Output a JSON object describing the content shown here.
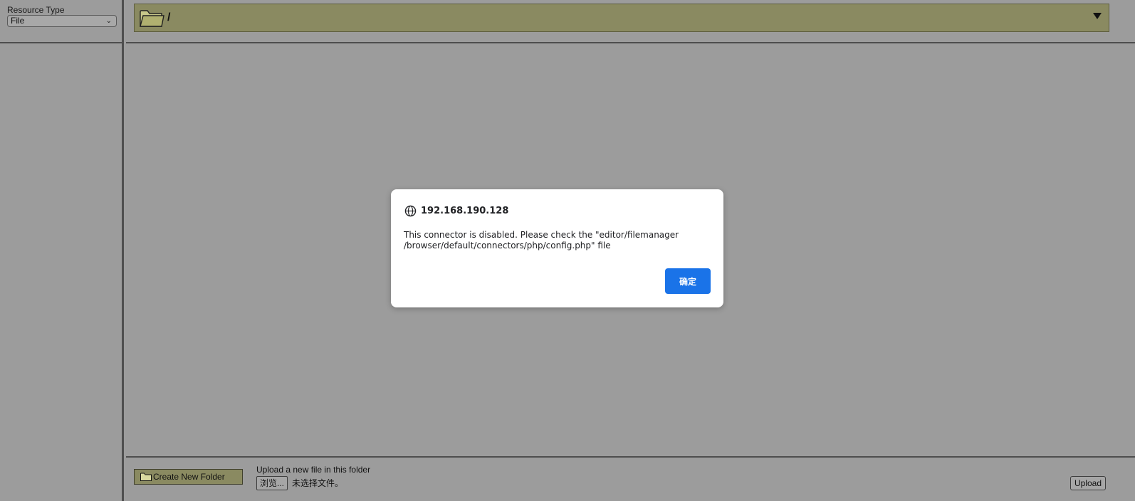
{
  "sidebar": {
    "resource_type_label": "Resource Type",
    "resource_type_value": "File"
  },
  "path_bar": {
    "current_path": "/"
  },
  "dialog": {
    "host": "192.168.190.128",
    "message_line1": "This connector is disabled. Please check the \"editor/filemanager",
    "message_line2": "/browser/default/connectors/php/config.php\" file",
    "ok_label": "确定"
  },
  "footer": {
    "create_folder_label": "Create New Folder",
    "upload_label": "Upload a new file in this folder",
    "browse_label": "浏览...",
    "no_file_text": "未选择文件。",
    "upload_button_label": "Upload"
  },
  "icons": {
    "folder": "folder-icon",
    "globe": "globe-icon",
    "chevron": "chevron-down-icon",
    "dropdown": "triangle-down-icon"
  },
  "colors": {
    "background": "#9c9c9c",
    "folder_bar": "#8a8a61",
    "accent_button": "#1a73e8",
    "dialog_bg": "#ffffff"
  }
}
